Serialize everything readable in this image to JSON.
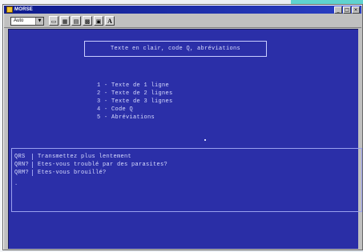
{
  "window": {
    "title": "MORSE",
    "controls": [
      "_",
      "□",
      "×"
    ]
  },
  "toolbar": {
    "font_select": {
      "value": "Auto",
      "arrow": "▼"
    },
    "buttons": [
      {
        "icon": "window-icon",
        "glyph": "▭"
      },
      {
        "icon": "table-icon",
        "glyph": "▦"
      },
      {
        "icon": "print-icon",
        "glyph": "▤"
      },
      {
        "icon": "grid-icon",
        "glyph": "▩"
      },
      {
        "icon": "text-window-icon",
        "glyph": "▣"
      },
      {
        "icon": "letter-a-icon",
        "glyph": "A"
      }
    ]
  },
  "screen": {
    "header": "Texte en clair, code Q, abréviations",
    "menu": [
      "1 - Texte de 1 ligne",
      "2 - Texte de 2 lignes",
      "3 - Texte de 3 lignes",
      "4 - Code Q",
      "5 - Abréviations"
    ],
    "q_codes": [
      {
        "code": "QRS",
        "text": "Transmettez plus lentement"
      },
      {
        "code": "QRN?",
        "text": "Etes-vous troublé par des parasites?"
      },
      {
        "code": "QRM?",
        "text": "Etes-vous brouillé?"
      }
    ],
    "cursor": "."
  },
  "colors": {
    "screen_bg": "#2b2fa8",
    "screen_text": "#d8dcff",
    "titlebar": "#0e1b8c",
    "accent_corner": "#5fd3cf"
  }
}
